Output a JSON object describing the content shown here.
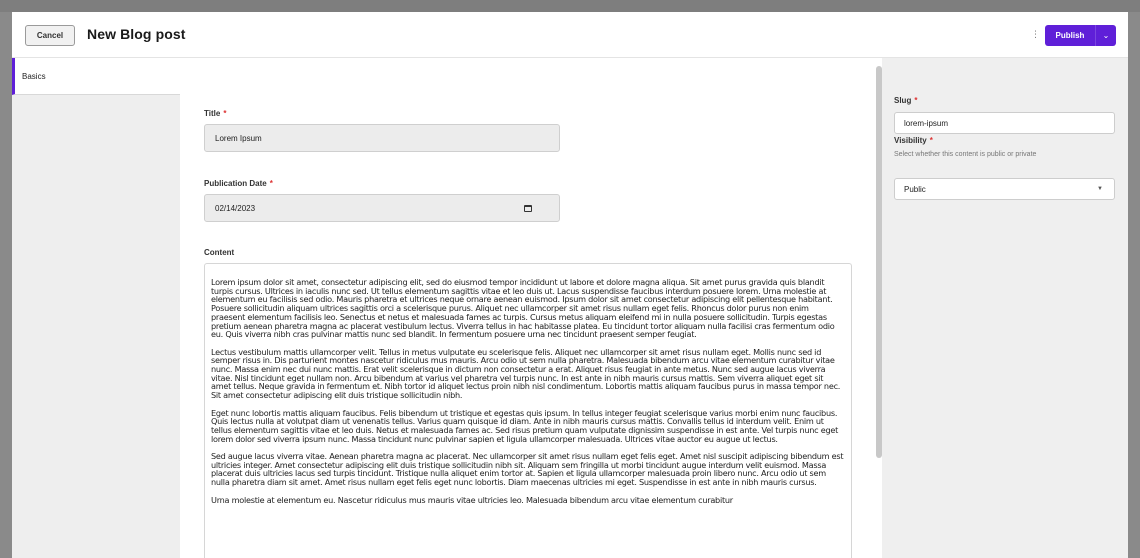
{
  "header": {
    "cancel_label": "Cancel",
    "title": "New Blog post",
    "more_icon": "kebab-vertical-icon",
    "publish_label": "Publish",
    "publish_caret_icon": "chevron-down-icon"
  },
  "colors": {
    "accent": "#5f1fd8",
    "required": "#dd3333"
  },
  "tabs": [
    {
      "label": "Basics",
      "active": true
    }
  ],
  "fields": {
    "title": {
      "label": "Title",
      "required_mark": "*",
      "value": "Lorem Ipsum"
    },
    "publication_date": {
      "label": "Publication Date",
      "required_mark": "*",
      "value": "02/14/2023",
      "icon": "calendar-icon"
    },
    "content": {
      "label": "Content",
      "paragraphs": [
        "Lorem ipsum dolor sit amet, consectetur adipiscing elit, sed do eiusmod tempor incididunt ut labore et dolore magna aliqua. Sit amet purus gravida quis blandit turpis cursus. Ultrices in iaculis nunc sed. Ut tellus elementum sagittis vitae et leo duis ut. Lacus suspendisse faucibus interdum posuere lorem. Urna molestie at elementum eu facilisis sed odio. Mauris pharetra et ultrices neque ornare aenean euismod. Ipsum dolor sit amet consectetur adipiscing elit pellentesque habitant. Posuere sollicitudin aliquam ultrices sagittis orci a scelerisque purus. Aliquet nec ullamcorper sit amet risus nullam eget felis. Rhoncus dolor purus non enim praesent elementum facilisis leo. Senectus et netus et malesuada fames ac turpis. Cursus metus aliquam eleifend mi in nulla posuere sollicitudin. Turpis egestas pretium aenean pharetra magna ac placerat vestibulum lectus. Viverra tellus in hac habitasse platea. Eu tincidunt tortor aliquam nulla facilisi cras fermentum odio eu. Quis viverra nibh cras pulvinar mattis nunc sed blandit. In fermentum posuere urna nec tincidunt praesent semper feugiat.",
        "Lectus vestibulum mattis ullamcorper velit. Tellus in metus vulputate eu scelerisque felis. Aliquet nec ullamcorper sit amet risus nullam eget. Mollis nunc sed id semper risus in. Dis parturient montes nascetur ridiculus mus mauris. Arcu odio ut sem nulla pharetra. Malesuada bibendum arcu vitae elementum curabitur vitae nunc. Massa enim nec dui nunc mattis. Erat velit scelerisque in dictum non consectetur a erat. Aliquet risus feugiat in ante metus. Nunc sed augue lacus viverra vitae. Nisl tincidunt eget nullam non. Arcu bibendum at varius vel pharetra vel turpis nunc. In est ante in nibh mauris cursus mattis. Sem viverra aliquet eget sit amet tellus. Neque gravida in fermentum et. Nibh tortor id aliquet lectus proin nibh nisl condimentum. Lobortis mattis aliquam faucibus purus in massa tempor nec. Sit amet consectetur adipiscing elit duis tristique sollicitudin nibh.",
        "Eget nunc lobortis mattis aliquam faucibus. Felis bibendum ut tristique et egestas quis ipsum. In tellus integer feugiat scelerisque varius morbi enim nunc faucibus. Quis lectus nulla at volutpat diam ut venenatis tellus. Varius quam quisque id diam. Ante in nibh mauris cursus mattis. Convallis tellus id interdum velit. Enim ut tellus elementum sagittis vitae et leo duis. Netus et malesuada fames ac. Sed risus pretium quam vulputate dignissim suspendisse in est ante. Vel turpis nunc eget lorem dolor sed viverra ipsum nunc. Massa tincidunt nunc pulvinar sapien et ligula ullamcorper malesuada. Ultrices vitae auctor eu augue ut lectus.",
        "Sed augue lacus viverra vitae. Aenean pharetra magna ac placerat. Nec ullamcorper sit amet risus nullam eget felis eget. Amet nisl suscipit adipiscing bibendum est ultricies integer. Amet consectetur adipiscing elit duis tristique sollicitudin nibh sit. Aliquam sem fringilla ut morbi tincidunt augue interdum velit euismod. Massa placerat duis ultricies lacus sed turpis tincidunt. Tristique nulla aliquet enim tortor at. Sapien et ligula ullamcorper malesuada proin libero nunc. Arcu odio ut sem nulla pharetra diam sit amet. Amet risus nullam eget felis eget nunc lobortis. Diam maecenas ultricies mi eget. Suspendisse in est ante in nibh mauris cursus.",
        "Urna molestie at elementum eu. Nascetur ridiculus mus mauris vitae ultricies leo. Malesuada bibendum arcu vitae elementum curabitur"
      ]
    }
  },
  "sidebar": {
    "slug": {
      "label": "Slug",
      "required_mark": "*",
      "value": "lorem-ipsum"
    },
    "visibility": {
      "label": "Visibility",
      "required_mark": "*",
      "hint": "Select whether this content is public or private",
      "selected": "Public",
      "caret_icon": "caret-down-icon"
    }
  }
}
